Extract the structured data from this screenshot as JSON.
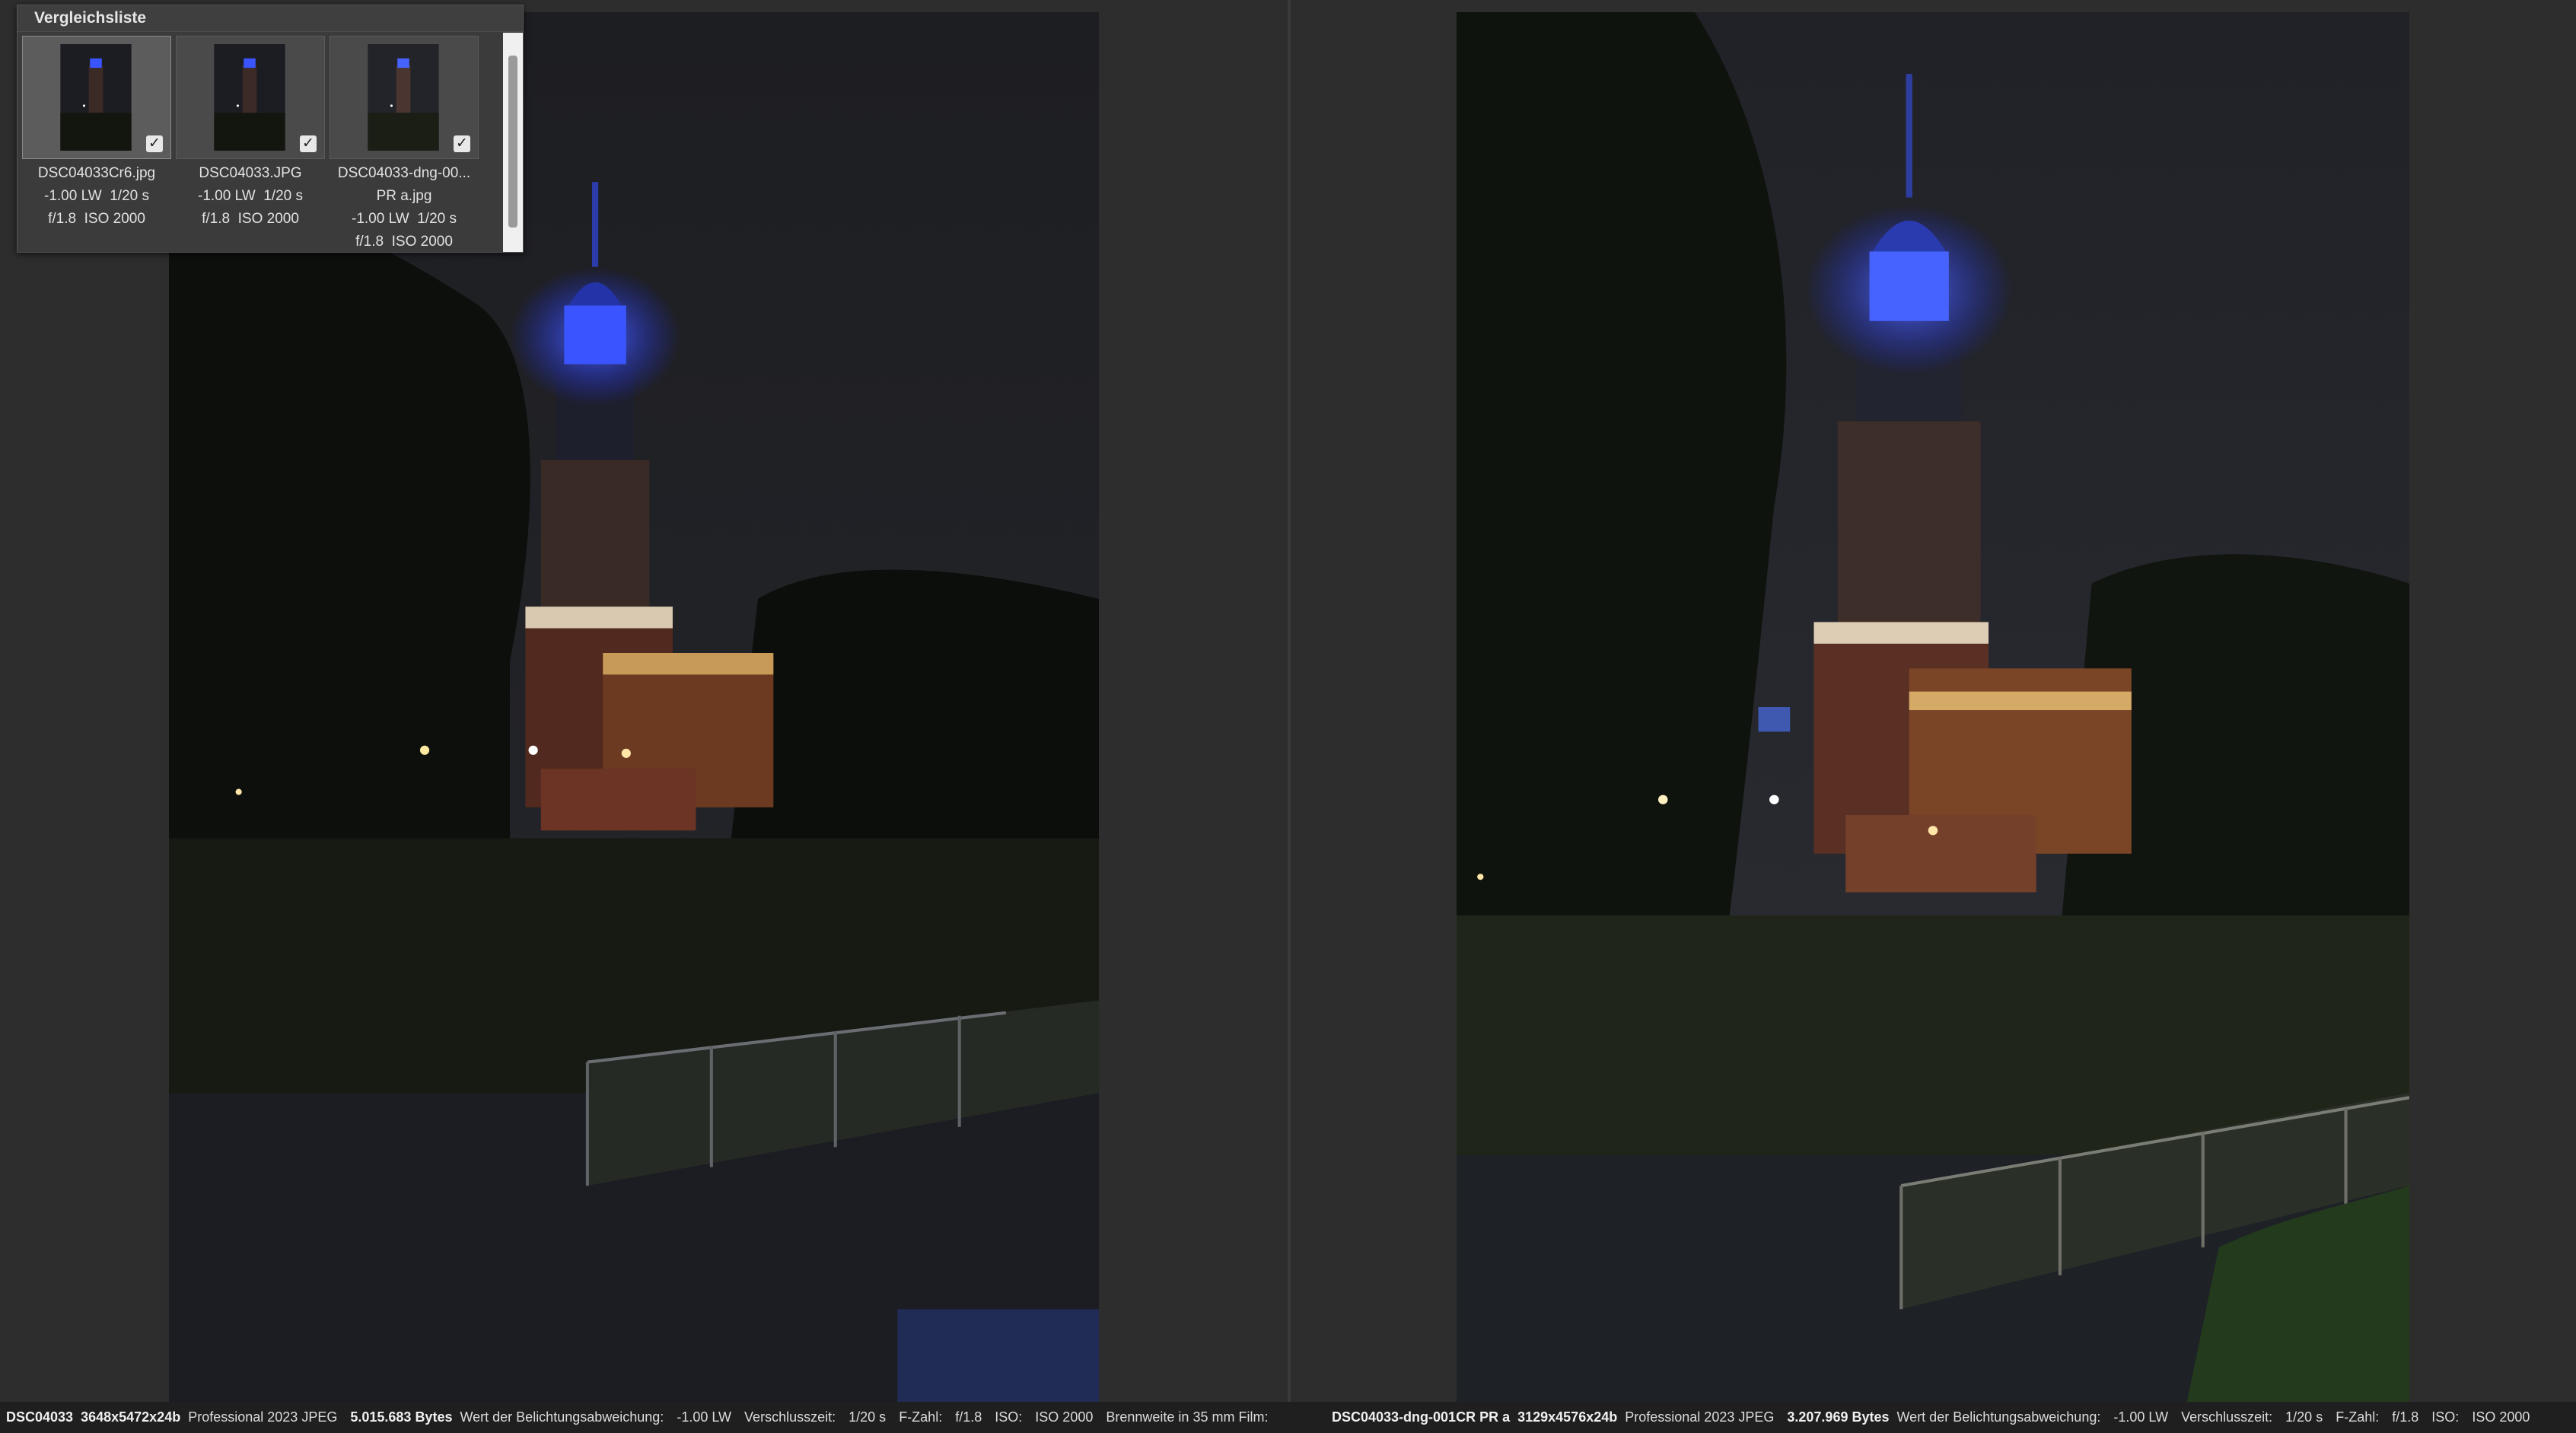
{
  "compare_list": {
    "title": "Vergleichsliste",
    "thumbnails": [
      {
        "caption": "DSC04033Cr6.jpg\n-1.00 LW  1/20 s\nf/1.8  ISO 2000",
        "checked": true
      },
      {
        "caption": "DSC04033.JPG\n-1.00 LW  1/20 s\nf/1.8  ISO 2000",
        "checked": true
      },
      {
        "caption": "DSC04033-dng-00...\nPR a.jpg\n-1.00 LW  1/20 s\nf/1.8  ISO 2000",
        "checked": true
      }
    ],
    "check_glyph": "✓"
  },
  "status_left": {
    "filename": "DSC04033",
    "dimensions": "3648x5472x24b",
    "format": "Professional 2023 JPEG",
    "size": "5.015.683 Bytes",
    "exposure_comp_label": "Wert der Belichtungsabweichung:",
    "exposure_comp": "-1.00 LW",
    "shutter_label": "Verschlusszeit:",
    "shutter": "1/20 s",
    "aperture_label": "F-Zahl:",
    "aperture": "f/1.8",
    "iso_label": "ISO:",
    "iso": "ISO 2000",
    "focal_label": "Brennweite in 35 mm Film:"
  },
  "status_right": {
    "filename": "DSC04033-dng-001CR PR a",
    "dimensions": "3129x4576x24b",
    "format": "Professional 2023 JPEG",
    "size": "3.207.969 Bytes",
    "exposure_comp_label": "Wert der Belichtungsabweichung:",
    "exposure_comp": "-1.00 LW",
    "shutter_label": "Verschlusszeit:",
    "shutter": "1/20 s",
    "aperture_label": "F-Zahl:",
    "aperture": "f/1.8",
    "iso_label": "ISO:",
    "iso": "ISO 2000"
  },
  "colors": {
    "background": "#2b2b2b",
    "tower_light": "#2b4dff",
    "sky": "#1c1e24",
    "statusbar": "#1f1f1f"
  }
}
